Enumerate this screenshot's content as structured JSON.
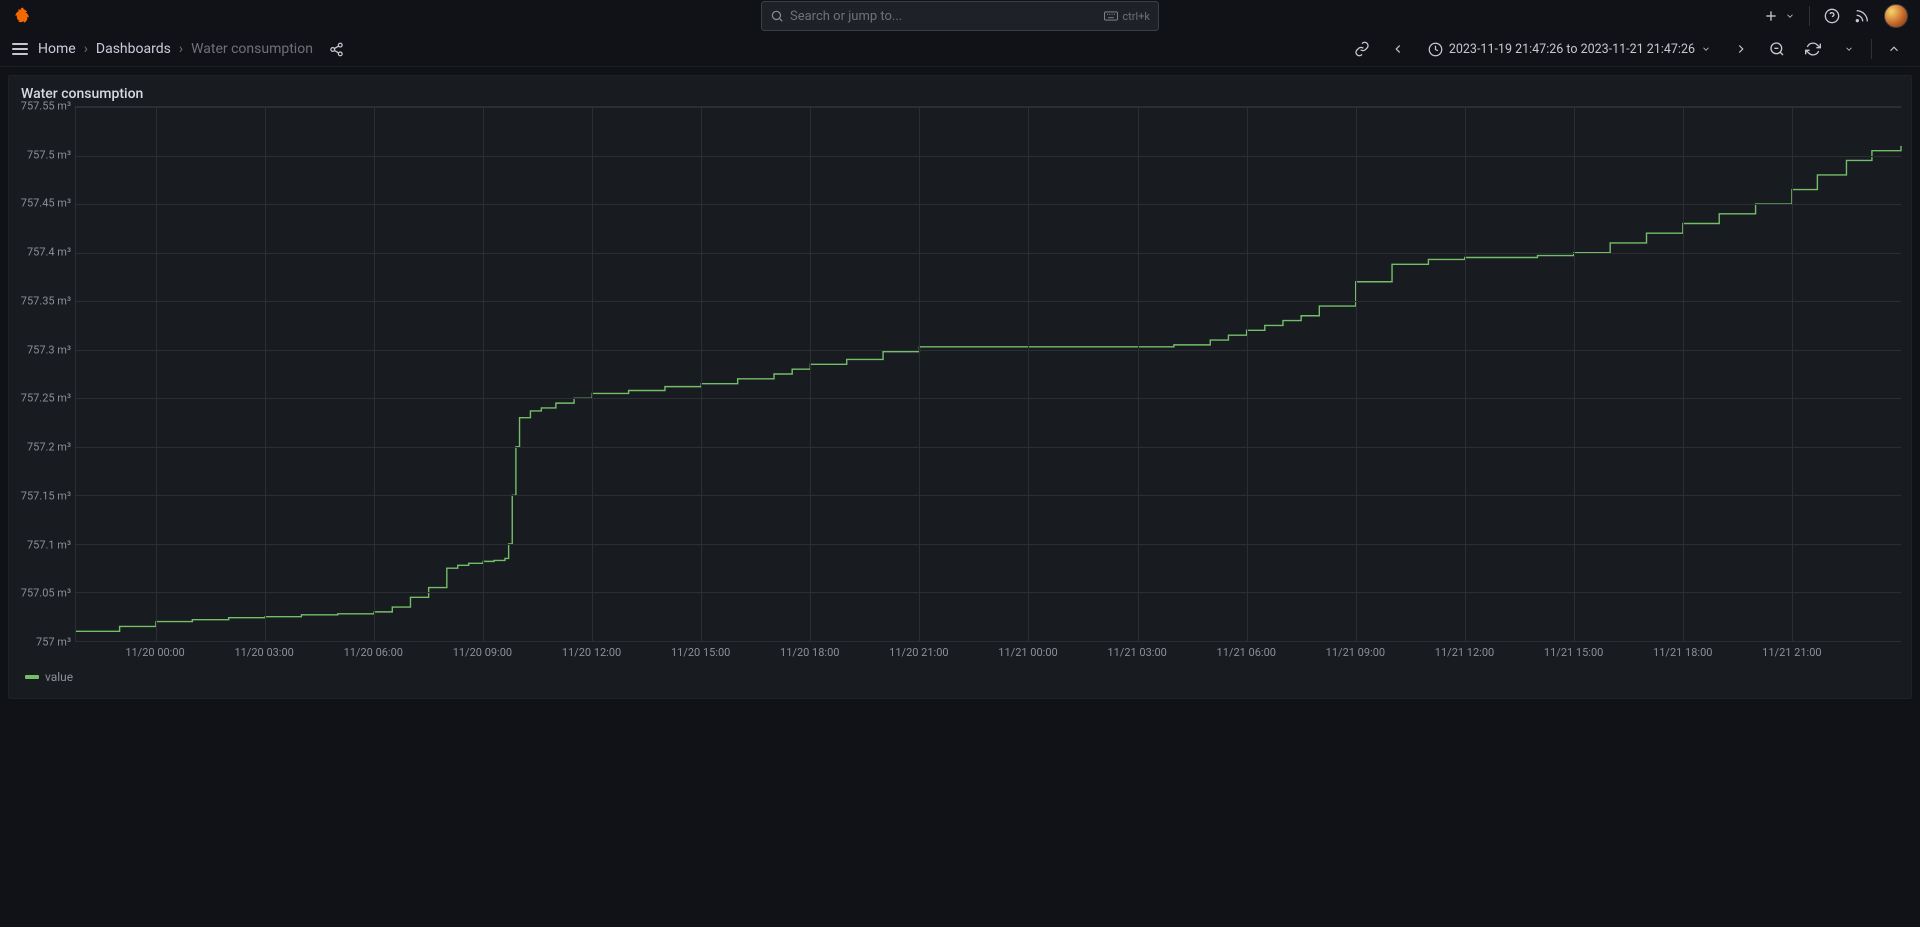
{
  "search": {
    "placeholder": "Search or jump to...",
    "shortcut": "ctrl+k"
  },
  "breadcrumbs": {
    "home": "Home",
    "dashboards": "Dashboards",
    "current": "Water consumption"
  },
  "time_picker": {
    "label": "2023-11-19 21:47:26 to 2023-11-21 21:47:26"
  },
  "panel": {
    "title": "Water consumption"
  },
  "legend": {
    "series_name": "value"
  },
  "yaxis": {
    "unit": "m³",
    "ticks": [
      757,
      757.05,
      757.1,
      757.15,
      757.2,
      757.25,
      757.3,
      757.35,
      757.4,
      757.45,
      757.5,
      757.55
    ],
    "labels": [
      "757 m³",
      "757.05 m³",
      "757.1 m³",
      "757.15 m³",
      "757.2 m³",
      "757.25 m³",
      "757.3 m³",
      "757.35 m³",
      "757.4 m³",
      "757.45 m³",
      "757.5 m³",
      "757.55 m³"
    ],
    "min": 757.0,
    "max": 757.55
  },
  "xaxis": {
    "labels": [
      "11/20 00:00",
      "11/20 03:00",
      "11/20 06:00",
      "11/20 09:00",
      "11/20 12:00",
      "11/20 15:00",
      "11/20 18:00",
      "11/20 21:00",
      "11/21 00:00",
      "11/21 03:00",
      "11/21 06:00",
      "11/21 09:00",
      "11/21 12:00",
      "11/21 15:00",
      "11/21 18:00",
      "11/21 21:00"
    ],
    "min_hour": -2.2,
    "max_hour": 48
  },
  "chart_data": {
    "type": "line",
    "title": "Water consumption",
    "xlabel": "",
    "ylabel": "m³",
    "ylim": [
      757.0,
      757.55
    ],
    "x_hours_since_1120_00": [
      -2.2,
      -1,
      0,
      1,
      2,
      3,
      4,
      5,
      6,
      6.5,
      7,
      7.5,
      8,
      8.3,
      8.6,
      9,
      9.3,
      9.6,
      9.7,
      9.8,
      9.9,
      10,
      10.3,
      10.6,
      11,
      11.5,
      12,
      13,
      14,
      15,
      16,
      17,
      17.5,
      18,
      19,
      20,
      21,
      22,
      23,
      24,
      27,
      28,
      29,
      29.5,
      30,
      30.5,
      31,
      31.5,
      32,
      33,
      34,
      35,
      36,
      37,
      38,
      39,
      40,
      41,
      42,
      43,
      44,
      45,
      45.7,
      46.5,
      47.2,
      48
    ],
    "values": [
      757.01,
      757.015,
      757.02,
      757.022,
      757.024,
      757.025,
      757.027,
      757.028,
      757.03,
      757.035,
      757.045,
      757.055,
      757.075,
      757.078,
      757.08,
      757.082,
      757.083,
      757.085,
      757.1,
      757.15,
      757.2,
      757.23,
      757.237,
      757.24,
      757.245,
      757.25,
      757.255,
      757.258,
      757.262,
      757.265,
      757.27,
      757.275,
      757.28,
      757.285,
      757.29,
      757.298,
      757.303,
      757.303,
      757.303,
      757.303,
      757.303,
      757.305,
      757.31,
      757.315,
      757.32,
      757.325,
      757.33,
      757.335,
      757.345,
      757.37,
      757.388,
      757.393,
      757.395,
      757.395,
      757.397,
      757.4,
      757.41,
      757.42,
      757.43,
      757.44,
      757.45,
      757.465,
      757.48,
      757.495,
      757.505,
      757.51
    ],
    "series": [
      {
        "name": "value"
      }
    ]
  }
}
